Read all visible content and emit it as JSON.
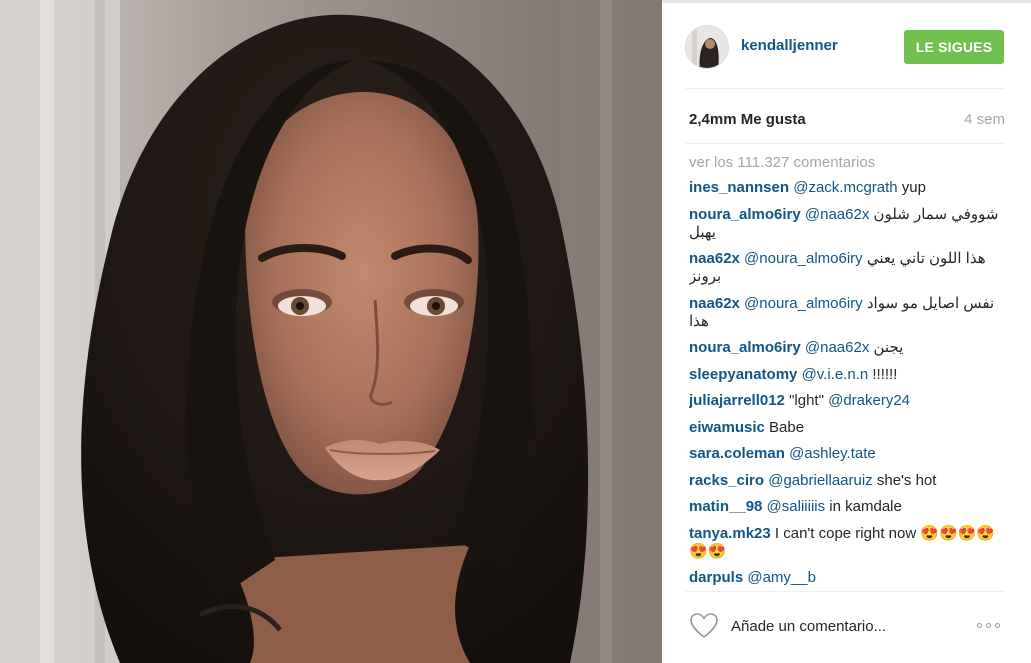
{
  "photo": {
    "subject": "portrait-photo"
  },
  "header": {
    "username": "kendalljenner",
    "follow_label": "LE SIGUES"
  },
  "stats": {
    "likes": "2,4mm Me gusta",
    "time": "4 sem"
  },
  "view_all": "ver los 111.327 comentarios",
  "comments": [
    {
      "user": "ines_nannsen",
      "mention": "@zack.mcgrath",
      "text": " yup"
    },
    {
      "user": "noura_almo6iry",
      "mention": "@naa62x",
      "text": " شووفي سمار شلون يهبل"
    },
    {
      "user": "naa62x",
      "mention": "@noura_almo6iry",
      "text": " هذا اللون تاني يعني برونز"
    },
    {
      "user": "naa62x",
      "mention": "@noura_almo6iry",
      "text": " نفس اصايل مو سواد هذا"
    },
    {
      "user": "noura_almo6iry",
      "mention": "@naa62x",
      "text": " يجنن"
    },
    {
      "user": "sleepyanatomy",
      "mention": "@v.i.e.n.n",
      "text": " !!!!!!"
    },
    {
      "user": "juliajarrell012",
      "mention": "",
      "text": " \"lght\" ",
      "mention2": "@drakery24"
    },
    {
      "user": "eiwamusic",
      "mention": "",
      "text": " Babe"
    },
    {
      "user": "sara.coleman",
      "mention": "@ashley.tate",
      "text": ""
    },
    {
      "user": "racks_ciro",
      "mention": "@gabriellaaruiz",
      "text": " she's hot"
    },
    {
      "user": "matin__98",
      "mention": "@saliiiiis",
      "text": " in kamdale"
    },
    {
      "user": "tanya.mk23",
      "mention": "",
      "text": " I can't cope right now 😍😍😍😍😍😍"
    },
    {
      "user": "darpuls",
      "mention": "@amy__b",
      "text": ""
    }
  ],
  "bottom": {
    "placeholder": "Añade un comentario...",
    "heart_icon": "heart-outline-icon",
    "more_icon": "more-options-icon"
  },
  "colors": {
    "username": "#125688",
    "follow_button": "#70c050",
    "muted": "#a5a7aa"
  }
}
